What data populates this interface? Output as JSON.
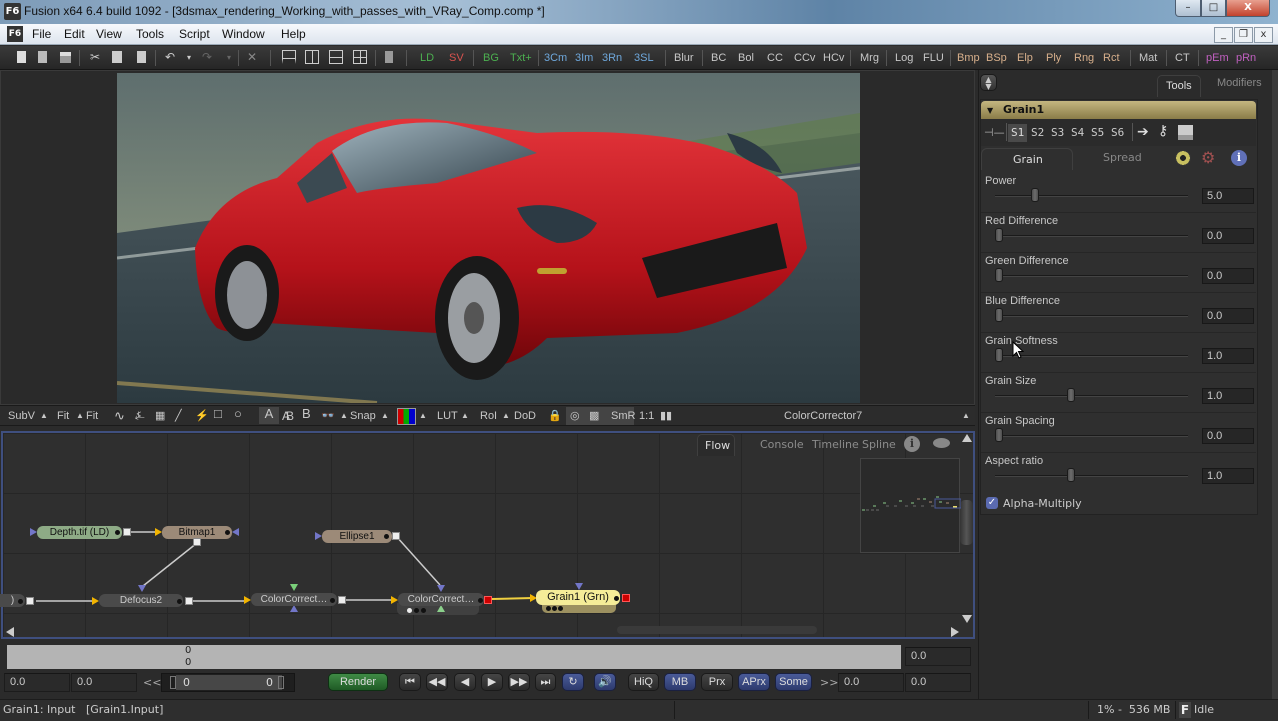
{
  "window": {
    "title": "Fusion x64 6.4 build 1092 - [3dsmax_rendering_Working_with_passes_with_VRay_Comp.comp *]",
    "logo": "F6",
    "controls": {
      "minimize": "–",
      "maximize": "□",
      "close": "X"
    }
  },
  "menubar": {
    "items": [
      "File",
      "Edit",
      "View",
      "Tools",
      "Script",
      "Window",
      "Help"
    ],
    "mdi_controls": {
      "minimize": "_",
      "restore": "❐",
      "close": "x"
    }
  },
  "toolbar": {
    "icons": [
      "new-icon",
      "open-icon",
      "save-icon",
      "cut-icon",
      "copy-icon",
      "paste-icon",
      "undo-icon",
      "redo-icon",
      "delete-icon",
      "layout1-icon",
      "layout2-icon",
      "layout3-icon",
      "layout4-icon",
      "script-icon"
    ],
    "tools": [
      {
        "label": "LD",
        "color": "#4caf50"
      },
      {
        "label": "SV",
        "color": "#d9534f"
      },
      {
        "label": "BG",
        "color": "#4caf50"
      },
      {
        "label": "Txt+",
        "color": "#4caf50"
      },
      {
        "label": "3Cm",
        "color": "#6fa8dc"
      },
      {
        "label": "3Im",
        "color": "#6fa8dc"
      },
      {
        "label": "3Rn",
        "color": "#6fa8dc"
      },
      {
        "label": "3SL",
        "color": "#6fa8dc"
      },
      {
        "label": "Blur",
        "color": "#c8c8c8"
      },
      {
        "label": "BC",
        "color": "#c8c8c8"
      },
      {
        "label": "Bol",
        "color": "#c8c8c8"
      },
      {
        "label": "CC",
        "color": "#c8c8c8"
      },
      {
        "label": "CCv",
        "color": "#c8c8c8"
      },
      {
        "label": "HCv",
        "color": "#c8c8c8"
      },
      {
        "label": "Mrg",
        "color": "#c8c8c8"
      },
      {
        "label": "Log",
        "color": "#c8c8c8"
      },
      {
        "label": "FLU",
        "color": "#c8c8c8"
      },
      {
        "label": "Bmp",
        "color": "#d8b08c"
      },
      {
        "label": "BSp",
        "color": "#d8b08c"
      },
      {
        "label": "Elp",
        "color": "#d8b08c"
      },
      {
        "label": "Ply",
        "color": "#d8b08c"
      },
      {
        "label": "Rng",
        "color": "#d8b08c"
      },
      {
        "label": "Rct",
        "color": "#d8b08c"
      },
      {
        "label": "Mat",
        "color": "#c8c8c8"
      },
      {
        "label": "CT",
        "color": "#c8c8c8"
      },
      {
        "label": "pEm",
        "color": "#c060c0"
      },
      {
        "label": "pRn",
        "color": "#c060c0"
      }
    ]
  },
  "viewer": {
    "image_alt": "Red sports car on wet road",
    "toolbar": {
      "subv": "SubV",
      "fit1": "Fit",
      "fit2": "Fit",
      "snap": "Snap",
      "lut": "LUT",
      "roi": "RoI",
      "dod": "DoD",
      "smr": "SmR",
      "ratio": "1:1",
      "a_label": "A",
      "ab_label": "AB",
      "b_label": "B",
      "current_tool": "ColorCorrector7"
    }
  },
  "flow": {
    "tabs": [
      "Flow",
      "Console",
      "Timeline",
      "Spline"
    ],
    "active_tab": "Flow",
    "nodes": [
      {
        "id": "depth",
        "label": "Depth.tif  (LD)",
        "type": "loader"
      },
      {
        "id": "bitmap1",
        "label": "Bitmap1",
        "type": "mask"
      },
      {
        "id": "ellipse1",
        "label": "Ellipse1",
        "type": "mask"
      },
      {
        "id": "prev",
        "label": ")",
        "type": "tool"
      },
      {
        "id": "defocus2",
        "label": "Defocus2",
        "type": "tool"
      },
      {
        "id": "cc1",
        "label": "ColorCorrect…",
        "type": "tool"
      },
      {
        "id": "cc2",
        "label": "ColorCorrect…",
        "type": "tool"
      },
      {
        "id": "grain1",
        "label": "Grain1  (Grn)",
        "type": "selected"
      }
    ]
  },
  "timeline": {
    "ruler_top": "0",
    "ruler_bottom": "0",
    "ruler_right_value": "0.0",
    "global_start": "0.0",
    "render_start": "0.0",
    "rewind_label": "<<",
    "range_start": "0",
    "range_end": "0",
    "render_label": "Render",
    "hiq": "HiQ",
    "mb": "MB",
    "prx": "Prx",
    "aprx": "APrx",
    "some": "Some",
    "ff_label": ">>",
    "render_end": "0.0",
    "global_end": "0.0"
  },
  "status": {
    "left": "Grain1: Input   [Grain1.Input]",
    "memory": "1% -  536 MB",
    "state_icon": "F",
    "state": "Idle"
  },
  "inspector": {
    "tabs": [
      "Tools",
      "Modifiers"
    ],
    "active_tab": "Tools",
    "tool_name": "Grain1",
    "slots": [
      "S1",
      "S2",
      "S3",
      "S4",
      "S5",
      "S6"
    ],
    "active_slot": "S1",
    "subtabs": [
      "Grain",
      "Spread"
    ],
    "active_subtab": "Grain",
    "controls": [
      {
        "label": "Power",
        "value": "5.0",
        "fraction": 0.25
      },
      {
        "label": "Red Difference",
        "value": "0.0",
        "fraction": 0.0
      },
      {
        "label": "Green Difference",
        "value": "0.0",
        "fraction": 0.0
      },
      {
        "label": "Blue Difference",
        "value": "0.0",
        "fraction": 0.0
      },
      {
        "label": "Grain Softness",
        "value": "1.0",
        "fraction": 0.0
      },
      {
        "label": "Grain Size",
        "value": "1.0",
        "fraction": 0.5
      },
      {
        "label": "Grain Spacing",
        "value": "0.0",
        "fraction": 0.0
      },
      {
        "label": "Aspect ratio",
        "value": "1.0",
        "fraction": 0.5
      }
    ],
    "alpha_multiply": {
      "label": "Alpha-Multiply",
      "checked": true
    }
  }
}
